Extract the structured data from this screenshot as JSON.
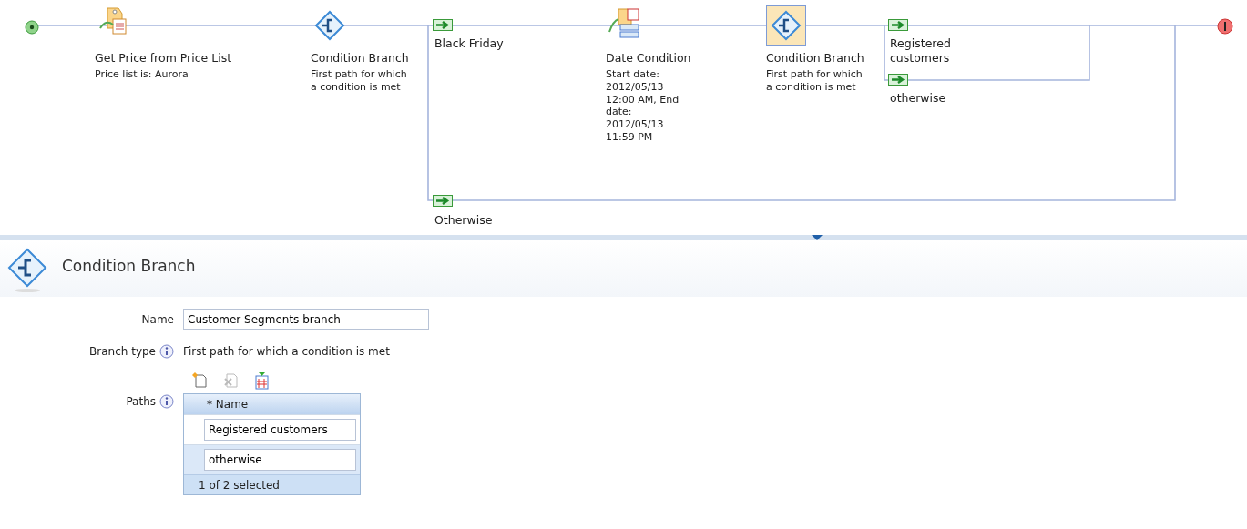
{
  "diagram": {
    "nodes": [
      {
        "kind": "start"
      },
      {
        "kind": "price",
        "title": "Get Price from Price List",
        "description": "Price list is: Aurora",
        "selected": false
      },
      {
        "kind": "branch",
        "title": "Condition Branch",
        "description": "First path for which a condition is met",
        "selected": false
      },
      {
        "kind": "date",
        "title": "Date Condition",
        "description": "Start date: 2012/05/13 12:00 AM, End date: 2012/05/13 11:59 PM",
        "selected": false
      },
      {
        "kind": "branch",
        "title": "Condition Branch",
        "description": "First path for which a condition is met",
        "selected": true
      },
      {
        "kind": "end"
      }
    ],
    "paths": [
      {
        "label": "Black Friday"
      },
      {
        "label": "Otherwise"
      },
      {
        "label": "Registered customers"
      },
      {
        "label": "otherwise"
      }
    ]
  },
  "panel": {
    "title": "Condition Branch",
    "name": {
      "label": "Name",
      "value": "Customer Segments branch"
    },
    "branch_type": {
      "label": "Branch type",
      "value": "First path for which a condition is met"
    },
    "paths": {
      "label": "Paths",
      "column": "* Name",
      "rows": [
        {
          "value": "Registered customers",
          "selected": false
        },
        {
          "value": "otherwise",
          "selected": true
        }
      ],
      "footer": "1 of 2 selected"
    }
  }
}
